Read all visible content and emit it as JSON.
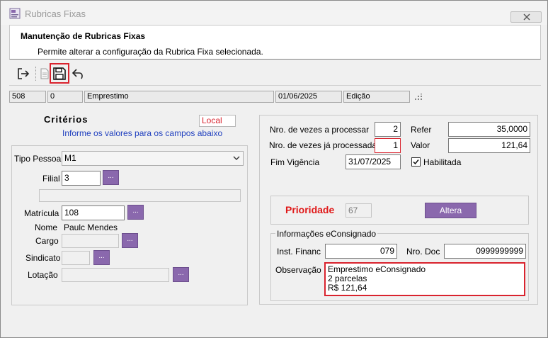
{
  "window": {
    "title": "Rubricas Fixas"
  },
  "header": {
    "title": "Manutenção de Rubricas Fixas",
    "subtitle": "Permite alterar a configuração da Rubrica Fixa selecionada."
  },
  "statusbar": {
    "code": "508",
    "seq": "0",
    "name": "Emprestimo",
    "date": "01/06/2025",
    "mode": "Edição"
  },
  "criteria": {
    "title": "Critérios",
    "local_badge": "Local",
    "hint": "Informe os valores para os campos abaixo",
    "tipo_pessoa_label": "Tipo Pessoa",
    "tipo_pessoa_value": "M1",
    "filial_label": "Filial",
    "filial_value": "3",
    "filial_desc": "",
    "matricula_label": "Matrícula",
    "matricula_value": "108",
    "nome_label": "Nome",
    "nome_value": "Paulc Mendes",
    "cargo_label": "Cargo",
    "cargo_value": "",
    "sindicato_label": "Sindicato",
    "sindicato_value": "",
    "lotacao_label": "Lotação",
    "lotacao_value": "",
    "lookup_label": "..."
  },
  "params": {
    "nro_processar_label": "Nro. de vezes a processar",
    "nro_processar_value": "2",
    "nro_processadas_label": "Nro. de vezes já processadas",
    "nro_processadas_value": "1",
    "refer_label": "Refer",
    "refer_value": "35,0000",
    "valor_label": "Valor",
    "valor_value": "121,64",
    "fim_vigencia_label": "Fim Vigência",
    "fim_vigencia_value": "31/07/2025",
    "habilitada_label": "Habilitada",
    "habilitada_checked": true
  },
  "prioridade": {
    "label": "Prioridade",
    "value": "67",
    "button_label": "Altera"
  },
  "econsignado": {
    "group_title": "Informações eConsignado",
    "inst_financ_label": "Inst. Financ",
    "inst_financ_value": "079",
    "nro_doc_label": "Nro. Doc",
    "nro_doc_value": "0999999999",
    "observacao_label": "Observação",
    "observacao_lines": [
      "Emprestimo eConsignado",
      "2 parcelas",
      "R$ 121,64"
    ]
  },
  "colors": {
    "accent_purple": "#8a68ad",
    "highlight_red": "#d9232e",
    "link_blue": "#1f3fbf",
    "prioridade_red": "#e01818"
  }
}
